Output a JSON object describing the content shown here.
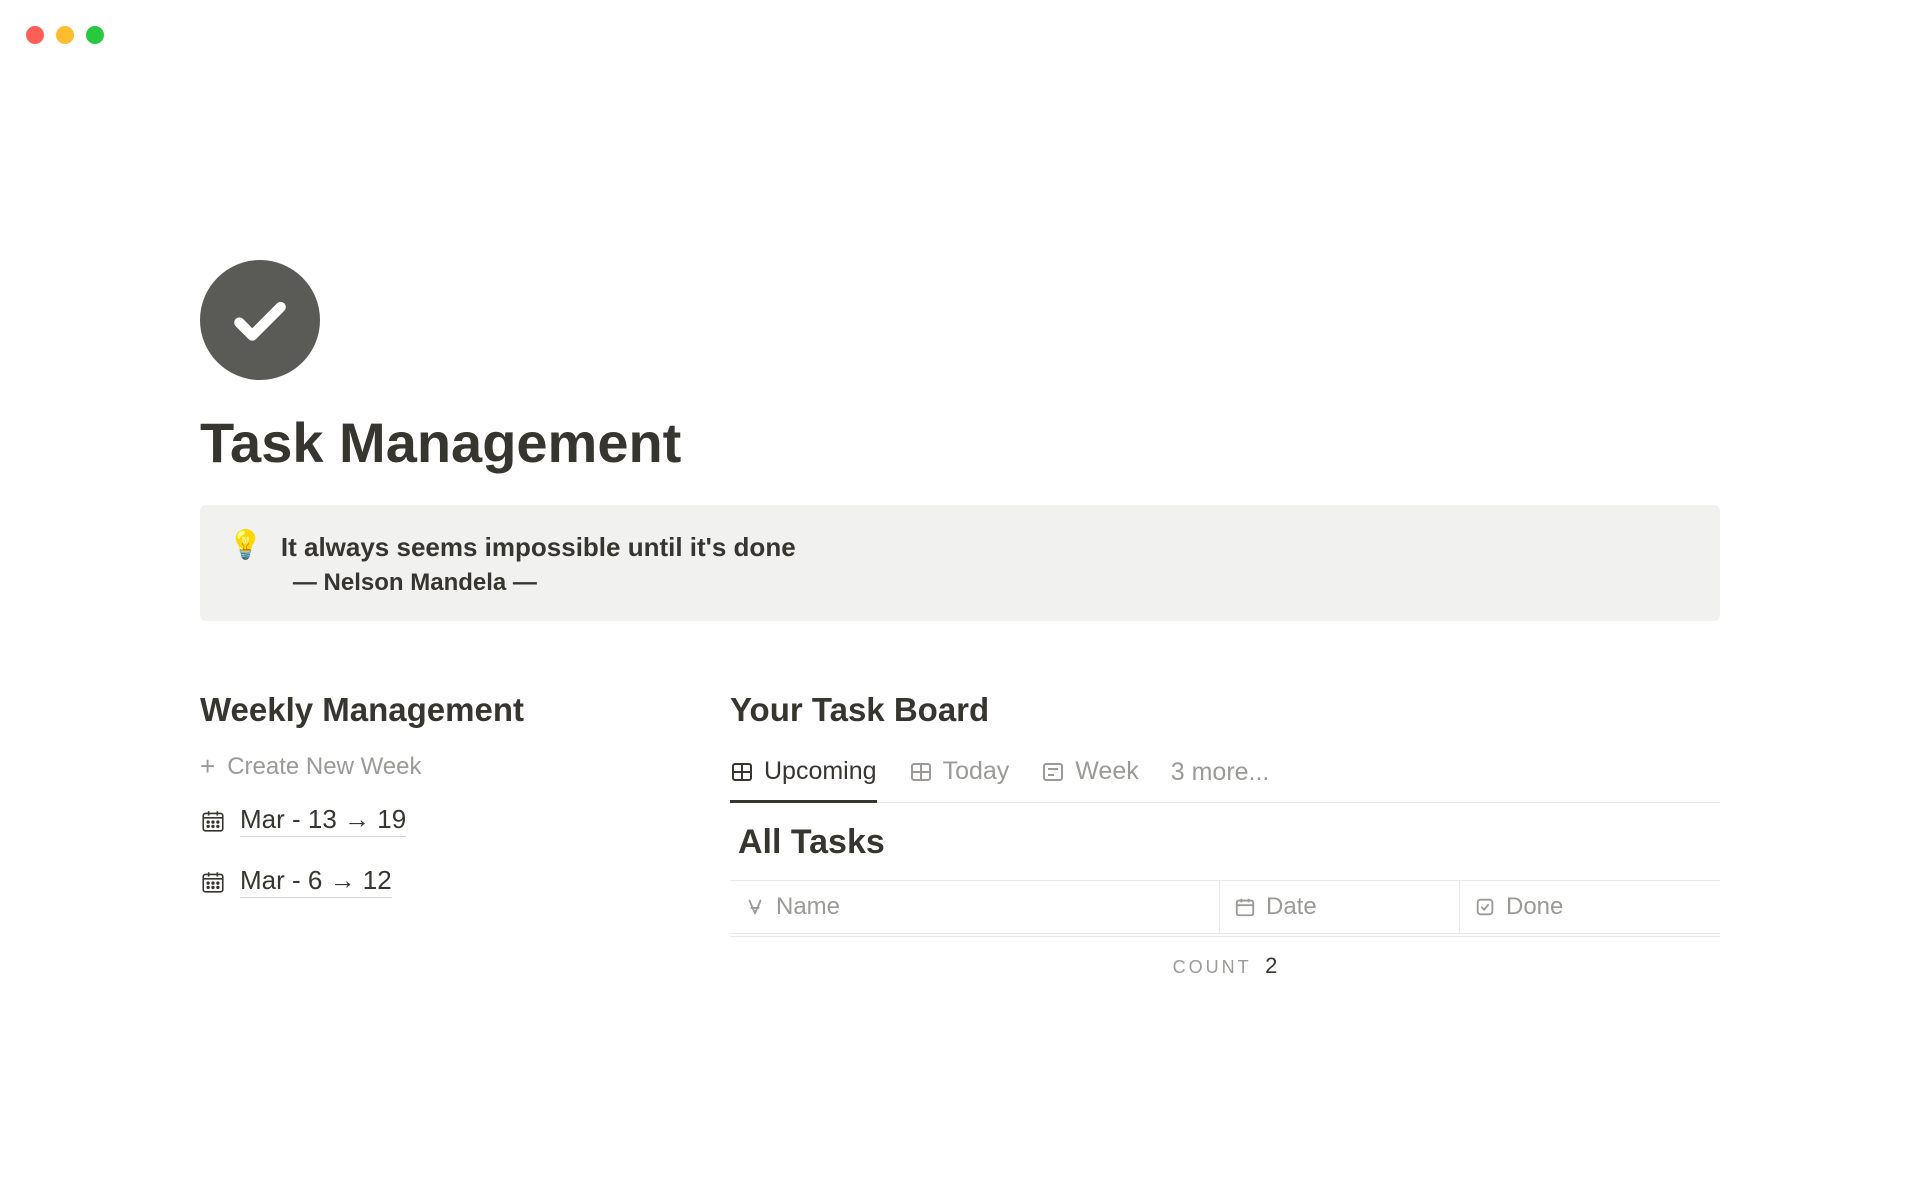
{
  "page": {
    "title": "Task Management"
  },
  "callout": {
    "icon": "💡",
    "quote": "It always seems impossible until it's done",
    "author": "— Nelson Mandela —"
  },
  "weekly": {
    "title": "Weekly Management",
    "create_label": "Create New Week",
    "weeks": [
      {
        "label": "Mar - 13 → 19"
      },
      {
        "label": "Mar - 6 → 12"
      }
    ]
  },
  "board": {
    "title": "Your Task Board",
    "tabs": [
      {
        "label": "Upcoming",
        "icon": "table",
        "active": true
      },
      {
        "label": "Today",
        "icon": "table",
        "active": false
      },
      {
        "label": "Week",
        "icon": "list",
        "active": false
      }
    ],
    "more_label": "3 more...",
    "subsection": "All Tasks",
    "columns": [
      {
        "label": "Name",
        "icon": "text"
      },
      {
        "label": "Date",
        "icon": "calendar"
      },
      {
        "label": "Done",
        "icon": "checkbox"
      }
    ],
    "count_label": "count",
    "count_value": "2"
  }
}
